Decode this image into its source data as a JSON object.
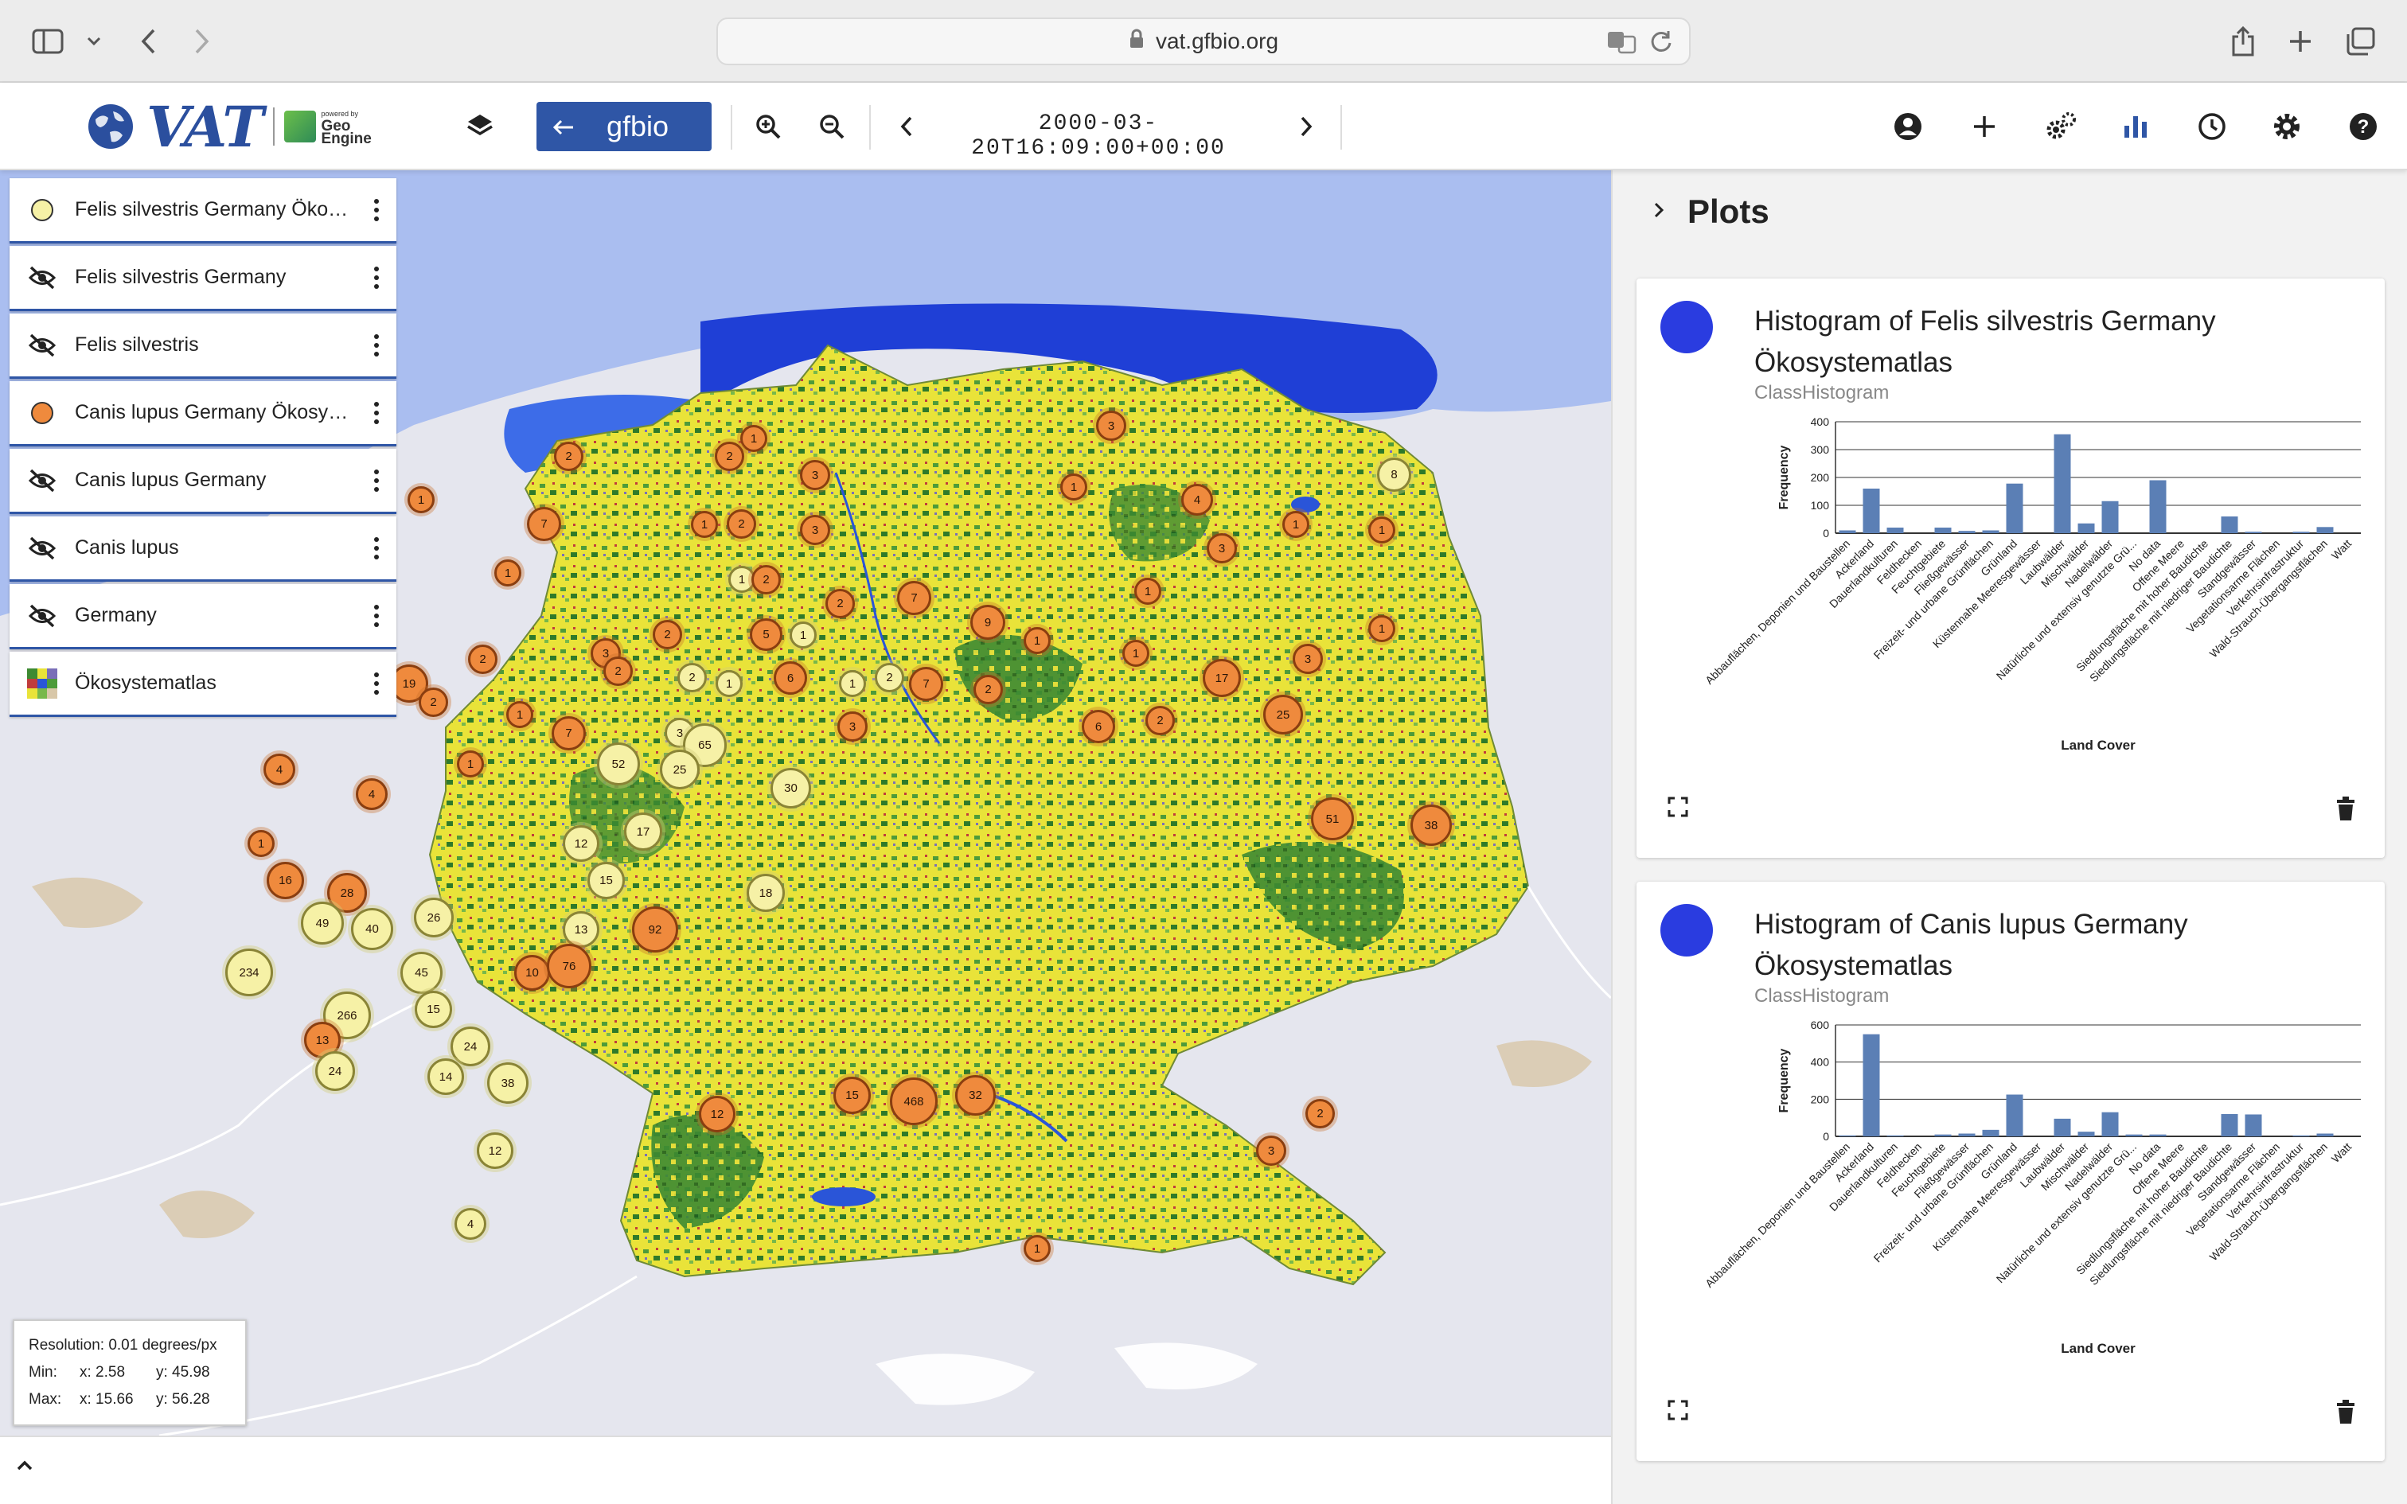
{
  "browser": {
    "url": "vat.gfbio.org",
    "icons": [
      "sidebar-icon",
      "chevron-down-icon",
      "back-icon",
      "forward-icon",
      "lock-icon",
      "translate-icon",
      "reload-icon",
      "share-icon",
      "new-tab-icon",
      "tabs-overview-icon"
    ]
  },
  "toolbar": {
    "logo_text": "VAT",
    "powered_by": "powered by",
    "geo_engine_line1": "Geo",
    "geo_engine_line2": "Engine",
    "gfbio_label": "gfbio",
    "timestamp": "2000-03-20T16:09:00+00:00",
    "accent_color": "#2f56a6"
  },
  "layers": [
    {
      "name": "Felis silvestris Germany Ökosystematlas",
      "visible": true,
      "symbol": "dot",
      "color": "#f6f1a6"
    },
    {
      "name": "Felis silvestris Germany",
      "visible": false,
      "symbol": "eye-off"
    },
    {
      "name": "Felis silvestris",
      "visible": false,
      "symbol": "eye-off"
    },
    {
      "name": "Canis lupus Germany Ökosystematlas",
      "visible": true,
      "symbol": "dot",
      "color": "#ef8a3d"
    },
    {
      "name": "Canis lupus Germany",
      "visible": false,
      "symbol": "eye-off"
    },
    {
      "name": "Canis lupus",
      "visible": false,
      "symbol": "eye-off"
    },
    {
      "name": "Germany",
      "visible": false,
      "symbol": "eye-off"
    },
    {
      "name": "Ökosystematlas",
      "visible": true,
      "symbol": "raster"
    }
  ],
  "resolution": {
    "resolution_text": "Resolution: 0.01 degrees/px",
    "min_label": "Min:",
    "min_x": "x: 2.58",
    "min_y": "y: 45.98",
    "max_label": "Max:",
    "max_x": "x: 15.66",
    "max_y": "y: 56.28"
  },
  "plots": {
    "title": "Plots",
    "cards": [
      {
        "title": "Histogram of Felis silvestris Germany Ökosystematlas",
        "subtitle": "ClassHistogram"
      },
      {
        "title": "Histogram of Canis lupus Germany Ökosystematlas",
        "subtitle": "ClassHistogram"
      }
    ]
  },
  "chart_data": [
    {
      "type": "bar",
      "categories": [
        "Abbauflächen, Deponien und Baustellen",
        "Ackerland",
        "Dauerlandkulturen",
        "Feldhecken",
        "Feuchtgebiete",
        "Fließgewässer",
        "Freizeit- und urbane Grünflächen",
        "Grünland",
        "Küstennahe Meeresgewässer",
        "Laubwälder",
        "Mischwälder",
        "Nadelwälder",
        "Natürliche und extensiv genutzte Grü...",
        "No data",
        "Offene Meere",
        "Siedlungsfläche mit hoher Baudichte",
        "Siedlungsfläche mit niedriger Baudichte",
        "Standgewässer",
        "Vegetationsarme Flächen",
        "Verkehrsinfrastruktur",
        "Wald-Strauch-Übergangsflächen",
        "Watt"
      ],
      "values": [
        10,
        160,
        20,
        0,
        20,
        8,
        10,
        178,
        0,
        355,
        35,
        115,
        0,
        190,
        0,
        0,
        60,
        5,
        0,
        5,
        22,
        0
      ],
      "xlabel": "Land Cover",
      "ylabel": "Frequency",
      "yticks": [
        0,
        100,
        200,
        300,
        400
      ],
      "ylim": [
        0,
        400
      ],
      "bar_color": "#5b7fb5"
    },
    {
      "type": "bar",
      "categories": [
        "Abbauflächen, Deponien und Baustellen",
        "Ackerland",
        "Dauerlandkulturen",
        "Feldhecken",
        "Feuchtgebiete",
        "Fließgewässer",
        "Freizeit- und urbane Grünflächen",
        "Grünland",
        "Küstennahe Meeresgewässer",
        "Laubwälder",
        "Mischwälder",
        "Nadelwälder",
        "Natürliche und extensiv genutzte Grü...",
        "No data",
        "Offene Meere",
        "Siedlungsfläche mit hoher Baudichte",
        "Siedlungsfläche mit niedriger Baudichte",
        "Standgewässer",
        "Vegetationsarme Flächen",
        "Verkehrsinfrastruktur",
        "Wald-Strauch-Übergangsflächen",
        "Watt"
      ],
      "values": [
        5,
        550,
        5,
        0,
        10,
        15,
        35,
        225,
        0,
        95,
        25,
        130,
        10,
        10,
        0,
        0,
        120,
        118,
        0,
        5,
        15,
        0
      ],
      "xlabel": "Land Cover",
      "ylabel": "Frequency",
      "yticks": [
        0,
        200,
        400,
        600
      ],
      "ylim": [
        0,
        600
      ],
      "bar_color": "#5b7fb5"
    }
  ],
  "map_clusters": [
    {
      "lon": 6.0,
      "lat": 53.6,
      "label": "1",
      "layer": "o"
    },
    {
      "lon": 7.2,
      "lat": 53.95,
      "label": "2",
      "layer": "o"
    },
    {
      "lon": 8.7,
      "lat": 54.1,
      "label": "1",
      "layer": "o"
    },
    {
      "lon": 8.5,
      "lat": 53.95,
      "label": "2",
      "layer": "o"
    },
    {
      "lon": 9.2,
      "lat": 53.8,
      "label": "3",
      "layer": "o"
    },
    {
      "lon": 11.6,
      "lat": 54.2,
      "label": "3",
      "layer": "o"
    },
    {
      "lon": 13.9,
      "lat": 53.8,
      "label": "8",
      "layer": "y"
    },
    {
      "lon": 7.0,
      "lat": 53.4,
      "label": "7",
      "layer": "o"
    },
    {
      "lon": 6.7,
      "lat": 53.0,
      "label": "1",
      "layer": "o"
    },
    {
      "lon": 8.3,
      "lat": 53.4,
      "label": "1",
      "layer": "o"
    },
    {
      "lon": 8.6,
      "lat": 53.4,
      "label": "2",
      "layer": "o"
    },
    {
      "lon": 9.2,
      "lat": 53.35,
      "label": "3",
      "layer": "o"
    },
    {
      "lon": 11.3,
      "lat": 53.7,
      "label": "1",
      "layer": "o"
    },
    {
      "lon": 12.3,
      "lat": 53.6,
      "label": "4",
      "layer": "o"
    },
    {
      "lon": 13.1,
      "lat": 53.4,
      "label": "1",
      "layer": "o"
    },
    {
      "lon": 13.8,
      "lat": 53.35,
      "label": "1",
      "layer": "o"
    },
    {
      "lon": 12.5,
      "lat": 53.2,
      "label": "3",
      "layer": "o"
    },
    {
      "lon": 8.6,
      "lat": 52.95,
      "label": "1",
      "layer": "y"
    },
    {
      "lon": 8.8,
      "lat": 52.95,
      "label": "2",
      "layer": "o"
    },
    {
      "lon": 9.4,
      "lat": 52.75,
      "label": "2",
      "layer": "o"
    },
    {
      "lon": 10.0,
      "lat": 52.8,
      "label": "7",
      "layer": "o"
    },
    {
      "lon": 10.6,
      "lat": 52.6,
      "label": "9",
      "layer": "o"
    },
    {
      "lon": 11.0,
      "lat": 52.45,
      "label": "1",
      "layer": "o"
    },
    {
      "lon": 11.9,
      "lat": 52.85,
      "label": "1",
      "layer": "o"
    },
    {
      "lon": 13.2,
      "lat": 52.3,
      "label": "3",
      "layer": "o"
    },
    {
      "lon": 13.8,
      "lat": 52.55,
      "label": "1",
      "layer": "o"
    },
    {
      "lon": 5.9,
      "lat": 52.1,
      "label": "19",
      "layer": "o"
    },
    {
      "lon": 6.5,
      "lat": 52.3,
      "label": "2",
      "layer": "o"
    },
    {
      "lon": 7.5,
      "lat": 52.35,
      "label": "3",
      "layer": "o"
    },
    {
      "lon": 8.0,
      "lat": 52.5,
      "label": "2",
      "layer": "o"
    },
    {
      "lon": 8.8,
      "lat": 52.5,
      "label": "5",
      "layer": "o"
    },
    {
      "lon": 9.1,
      "lat": 52.5,
      "label": "1",
      "layer": "y"
    },
    {
      "lon": 9.5,
      "lat": 52.1,
      "label": "1",
      "layer": "y"
    },
    {
      "lon": 9.8,
      "lat": 52.15,
      "label": "2",
      "layer": "y"
    },
    {
      "lon": 10.1,
      "lat": 52.1,
      "label": "7",
      "layer": "o"
    },
    {
      "lon": 11.8,
      "lat": 52.35,
      "label": "1",
      "layer": "o"
    },
    {
      "lon": 12.5,
      "lat": 52.15,
      "label": "17",
      "layer": "o"
    },
    {
      "lon": 6.1,
      "lat": 51.95,
      "label": "2",
      "layer": "o"
    },
    {
      "lon": 6.8,
      "lat": 51.85,
      "label": "1",
      "layer": "o"
    },
    {
      "lon": 7.6,
      "lat": 52.2,
      "label": "2",
      "layer": "o"
    },
    {
      "lon": 8.2,
      "lat": 52.15,
      "label": "2",
      "layer": "y"
    },
    {
      "lon": 8.5,
      "lat": 52.1,
      "label": "1",
      "layer": "y"
    },
    {
      "lon": 9.0,
      "lat": 52.15,
      "label": "6",
      "layer": "o"
    },
    {
      "lon": 10.6,
      "lat": 52.05,
      "label": "2",
      "layer": "o"
    },
    {
      "lon": 11.5,
      "lat": 51.75,
      "label": "6",
      "layer": "o"
    },
    {
      "lon": 12.0,
      "lat": 51.8,
      "label": "2",
      "layer": "o"
    },
    {
      "lon": 13.0,
      "lat": 51.85,
      "label": "25",
      "layer": "o"
    },
    {
      "lon": 7.2,
      "lat": 51.7,
      "label": "7",
      "layer": "o"
    },
    {
      "lon": 8.1,
      "lat": 51.7,
      "label": "3",
      "layer": "y"
    },
    {
      "lon": 8.3,
      "lat": 51.6,
      "label": "65",
      "layer": "y"
    },
    {
      "lon": 9.5,
      "lat": 51.75,
      "label": "3",
      "layer": "o"
    },
    {
      "lon": 4.85,
      "lat": 51.4,
      "label": "4",
      "layer": "o"
    },
    {
      "lon": 5.6,
      "lat": 51.2,
      "label": "4",
      "layer": "o"
    },
    {
      "lon": 6.4,
      "lat": 51.45,
      "label": "1",
      "layer": "o"
    },
    {
      "lon": 7.6,
      "lat": 51.45,
      "label": "52",
      "layer": "y"
    },
    {
      "lon": 8.1,
      "lat": 51.4,
      "label": "25",
      "layer": "y"
    },
    {
      "lon": 9.0,
      "lat": 51.25,
      "label": "30",
      "layer": "y"
    },
    {
      "lon": 13.4,
      "lat": 51.0,
      "label": "51",
      "layer": "o"
    },
    {
      "lon": 14.2,
      "lat": 50.95,
      "label": "38",
      "layer": "o"
    },
    {
      "lon": 4.7,
      "lat": 50.8,
      "label": "1",
      "layer": "o"
    },
    {
      "lon": 7.3,
      "lat": 50.8,
      "label": "12",
      "layer": "y"
    },
    {
      "lon": 7.8,
      "lat": 50.9,
      "label": "17",
      "layer": "y"
    },
    {
      "lon": 4.9,
      "lat": 50.5,
      "label": "16",
      "layer": "o"
    },
    {
      "lon": 5.4,
      "lat": 50.4,
      "label": "28",
      "layer": "o"
    },
    {
      "lon": 7.5,
      "lat": 50.5,
      "label": "15",
      "layer": "y"
    },
    {
      "lon": 8.8,
      "lat": 50.4,
      "label": "18",
      "layer": "y"
    },
    {
      "lon": 5.2,
      "lat": 50.15,
      "label": "49",
      "layer": "y"
    },
    {
      "lon": 5.6,
      "lat": 50.1,
      "label": "40",
      "layer": "y"
    },
    {
      "lon": 6.1,
      "lat": 50.2,
      "label": "26",
      "layer": "y"
    },
    {
      "lon": 7.3,
      "lat": 50.1,
      "label": "13",
      "layer": "y"
    },
    {
      "lon": 7.9,
      "lat": 50.1,
      "label": "92",
      "layer": "o"
    },
    {
      "lon": 4.6,
      "lat": 49.75,
      "label": "234",
      "layer": "y"
    },
    {
      "lon": 6.0,
      "lat": 49.75,
      "label": "45",
      "layer": "y"
    },
    {
      "lon": 6.9,
      "lat": 49.75,
      "label": "10",
      "layer": "o"
    },
    {
      "lon": 7.2,
      "lat": 49.8,
      "label": "76",
      "layer": "o"
    },
    {
      "lon": 5.4,
      "lat": 49.4,
      "label": "266",
      "layer": "y"
    },
    {
      "lon": 6.1,
      "lat": 49.45,
      "label": "15",
      "layer": "y"
    },
    {
      "lon": 5.2,
      "lat": 49.2,
      "label": "13",
      "layer": "o"
    },
    {
      "lon": 6.4,
      "lat": 49.15,
      "label": "24",
      "layer": "y"
    },
    {
      "lon": 5.3,
      "lat": 48.95,
      "label": "24",
      "layer": "y"
    },
    {
      "lon": 6.2,
      "lat": 48.9,
      "label": "14",
      "layer": "y"
    },
    {
      "lon": 6.7,
      "lat": 48.85,
      "label": "38",
      "layer": "y"
    },
    {
      "lon": 9.5,
      "lat": 48.75,
      "label": "15",
      "layer": "o"
    },
    {
      "lon": 10.0,
      "lat": 48.7,
      "label": "468",
      "layer": "o"
    },
    {
      "lon": 10.5,
      "lat": 48.75,
      "label": "32",
      "layer": "o"
    },
    {
      "lon": 8.4,
      "lat": 48.6,
      "label": "12",
      "layer": "o"
    },
    {
      "lon": 6.6,
      "lat": 48.3,
      "label": "12",
      "layer": "y"
    },
    {
      "lon": 6.4,
      "lat": 47.7,
      "label": "4",
      "layer": "y"
    },
    {
      "lon": 11.0,
      "lat": 47.5,
      "label": "1",
      "layer": "o"
    },
    {
      "lon": 13.3,
      "lat": 48.6,
      "label": "2",
      "layer": "o"
    },
    {
      "lon": 12.9,
      "lat": 48.3,
      "label": "3",
      "layer": "o"
    }
  ]
}
